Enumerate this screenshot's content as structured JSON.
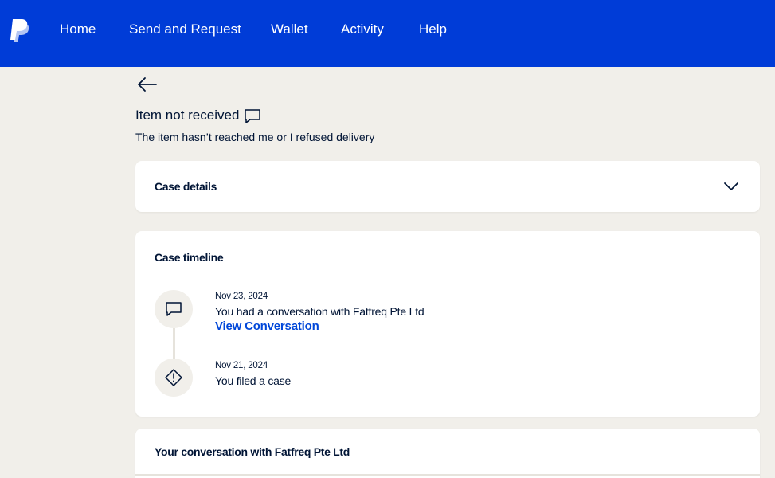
{
  "nav": {
    "logo_icon": "paypal-logo",
    "items": [
      "Home",
      "Send and Request",
      "Wallet",
      "Activity",
      "Help"
    ]
  },
  "page": {
    "back_icon": "arrow-left-icon",
    "title": "Item not received",
    "title_icon": "chat-bubble-icon",
    "subtitle": "The item hasn’t reached me or I refused delivery"
  },
  "case_details": {
    "title": "Case details",
    "toggle_icon": "chevron-down-icon"
  },
  "timeline": {
    "title": "Case timeline",
    "events": [
      {
        "icon": "chat-bubble-icon",
        "date": "Nov 23, 2024",
        "text": "You had a conversation with Fatfreq Pte Ltd",
        "link": "View Conversation"
      },
      {
        "icon": "alert-diamond-icon",
        "date": "Nov 21, 2024",
        "text": "You filed a case"
      }
    ]
  },
  "conversation": {
    "title": "Your conversation with Fatfreq Pte Ltd"
  },
  "colors": {
    "brand": "#003cd7",
    "background": "#f1efea",
    "link": "#0047d9",
    "text": "#001435"
  }
}
